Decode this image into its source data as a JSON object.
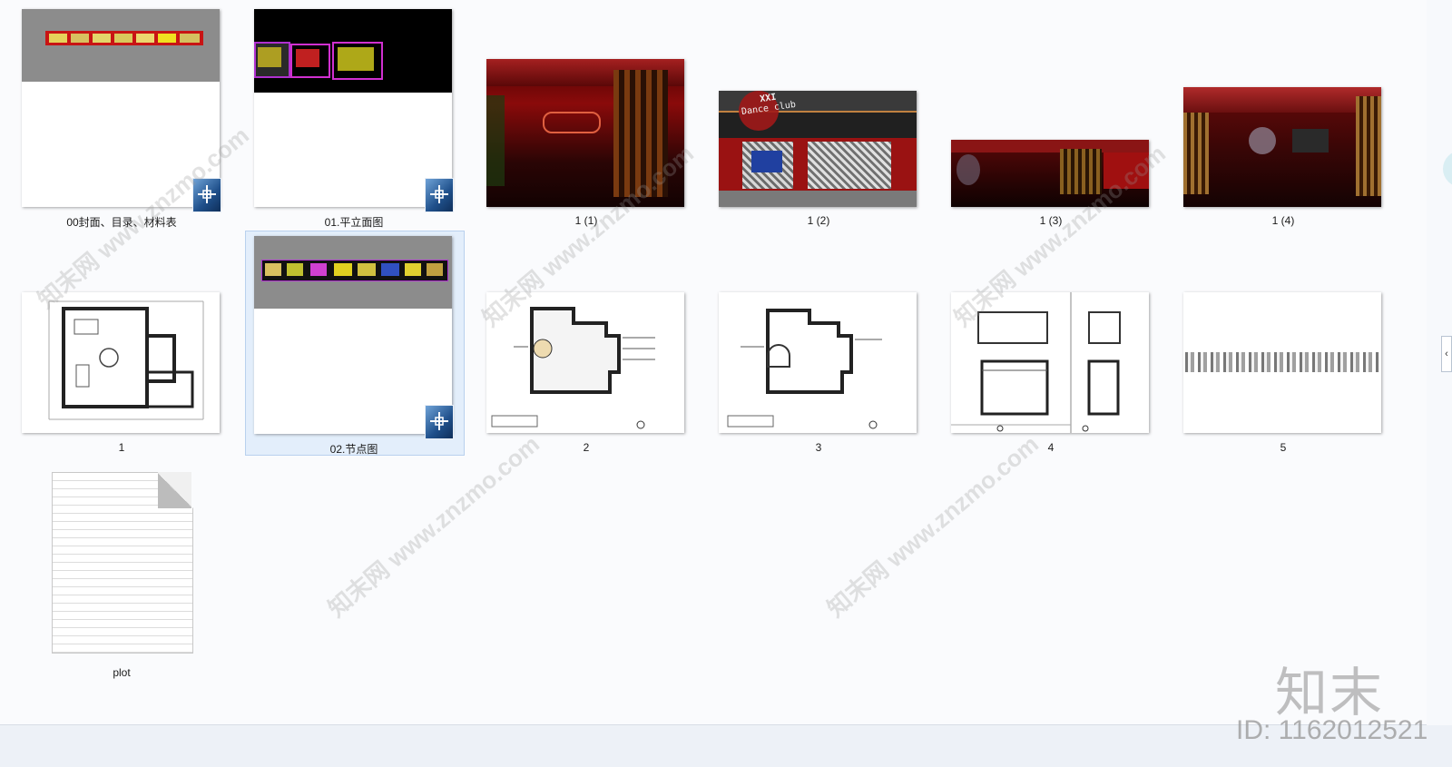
{
  "files": [
    {
      "label": "00封面、目录、材料表",
      "type": "cad"
    },
    {
      "label": "01.平立面图",
      "type": "cad"
    },
    {
      "label": "1 (1)",
      "type": "image"
    },
    {
      "label": "1 (2)",
      "type": "image"
    },
    {
      "label": "1 (3)",
      "type": "image"
    },
    {
      "label": "1 (4)",
      "type": "image"
    },
    {
      "label": "1",
      "type": "plan"
    },
    {
      "label": "02.节点图",
      "type": "cad",
      "selected": true
    },
    {
      "label": "2",
      "type": "plan"
    },
    {
      "label": "3",
      "type": "plan"
    },
    {
      "label": "4",
      "type": "plan"
    },
    {
      "label": "5",
      "type": "plan"
    },
    {
      "label": "plot",
      "type": "text-file"
    }
  ],
  "render_texts": {
    "club_sign_top": "XXI",
    "club_sign_bottom": "Dance club"
  },
  "watermark": {
    "site": "www.znzmo.com",
    "brand": "知末网",
    "logo": "知末",
    "id": "ID: 1162012521"
  },
  "colors": {
    "selection": "#e3eefb",
    "accent_red": "#b01010"
  }
}
